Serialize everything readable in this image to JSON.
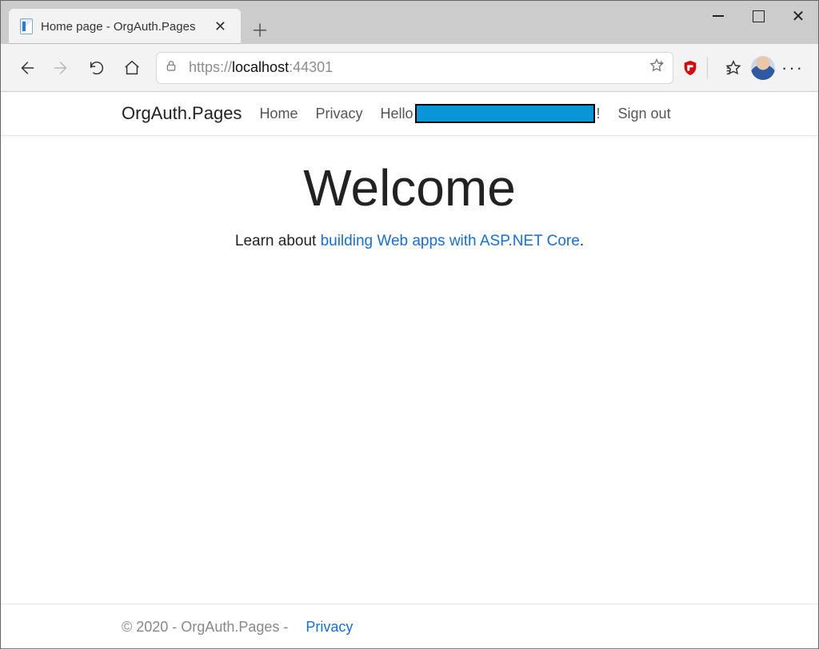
{
  "browser": {
    "tab_title": "Home page - OrgAuth.Pages",
    "address": {
      "scheme": "https://",
      "host": "localhost",
      "port": ":44301"
    }
  },
  "site": {
    "brand": "OrgAuth.Pages",
    "nav": {
      "home": "Home",
      "privacy": "Privacy"
    },
    "user": {
      "hello_prefix": "Hello",
      "hello_suffix": "!",
      "sign_out": "Sign out"
    }
  },
  "main": {
    "heading": "Welcome",
    "lead_prefix": "Learn about ",
    "lead_link": "building Web apps with ASP.NET Core",
    "lead_suffix": "."
  },
  "footer": {
    "text": "© 2020 - OrgAuth.Pages - ",
    "privacy": "Privacy"
  }
}
